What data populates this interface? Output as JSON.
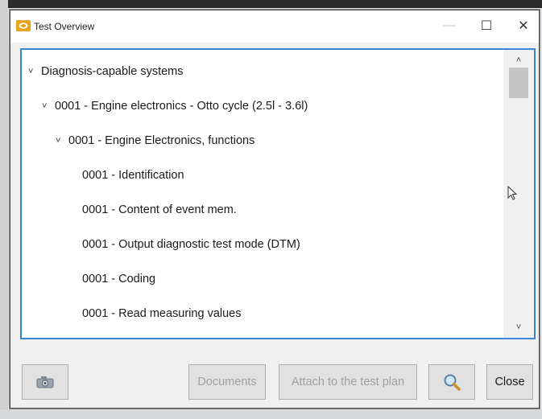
{
  "window": {
    "title": "Test Overview",
    "controls": {
      "minimize": "—",
      "maximize": "☐",
      "close": "✕"
    }
  },
  "tree": {
    "items": [
      {
        "label": "Diagnosis-capable systems",
        "level": 0,
        "expanded": true
      },
      {
        "label": "0001 - Engine electronics - Otto cycle (2.5l - 3.6l)",
        "level": 1,
        "expanded": true
      },
      {
        "label": "0001 - Engine Electronics, functions",
        "level": 2,
        "expanded": true
      },
      {
        "label": "0001 - Identification",
        "level": 3
      },
      {
        "label": "0001 - Content of event mem.",
        "level": 3
      },
      {
        "label": "0001 - Output diagnostic test mode (DTM)",
        "level": 3
      },
      {
        "label": "0001 - Coding",
        "level": 3
      },
      {
        "label": "0001 - Read measuring values",
        "level": 3
      }
    ],
    "chevron": "˅"
  },
  "scrollbar": {
    "up_arrow": "˄",
    "down_arrow": "˅"
  },
  "footer": {
    "camera_icon": "camera-icon",
    "documents_label": "Documents",
    "attach_label": "Attach to the test plan",
    "search_icon": "magnifier-icon",
    "close_label": "Close"
  },
  "colors": {
    "focus_border": "#3a86d4",
    "disabled_text": "#a0a0a0",
    "app_icon": "#e8a317"
  }
}
